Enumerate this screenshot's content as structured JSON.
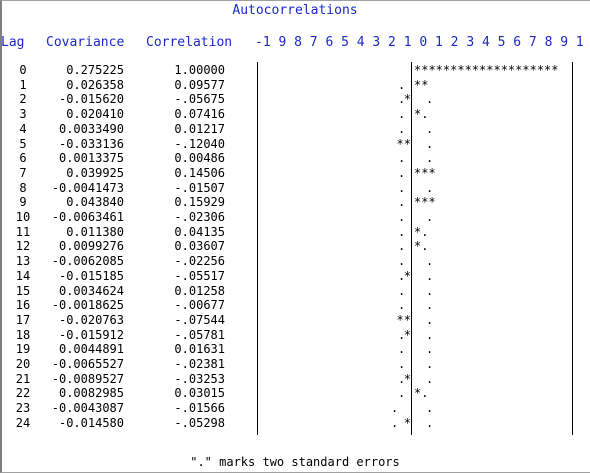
{
  "title": "Autocorrelations",
  "headers": {
    "lag": "Lag",
    "covariance": "Covariance",
    "correlation": "Correlation",
    "scale": "-1 9 8 7 6 5 4 3 2 1 0 1 2 3 4 5 6 7 8 9 1"
  },
  "rows": [
    {
      "lag": "0",
      "cov": "0.275225",
      "cor": "1.00000",
      "bar": "********************",
      "dir": "pos",
      "dots": "none"
    },
    {
      "lag": "1",
      "cov": "0.026358",
      "cor": "0.09577",
      "bar": "**",
      "dir": "pos",
      "dots": "l"
    },
    {
      "lag": "2",
      "cov": "-0.015620",
      "cor": "-.05675",
      "bar": "*",
      "dir": "neg",
      "dots": "lr"
    },
    {
      "lag": "3",
      "cov": "0.020410",
      "cor": "0.07416",
      "bar": "*.",
      "dir": "pos",
      "dots": "l"
    },
    {
      "lag": "4",
      "cov": "0.0033490",
      "cor": "0.01217",
      "bar": "",
      "dir": "pos",
      "dots": "lr"
    },
    {
      "lag": "5",
      "cov": "-0.033136",
      "cor": "-.12040",
      "bar": "**",
      "dir": "neg",
      "dots": "r"
    },
    {
      "lag": "6",
      "cov": "0.0013375",
      "cor": "0.00486",
      "bar": "",
      "dir": "pos",
      "dots": "lr"
    },
    {
      "lag": "7",
      "cov": "0.039925",
      "cor": "0.14506",
      "bar": "***",
      "dir": "pos",
      "dots": "l"
    },
    {
      "lag": "8",
      "cov": "-0.0041473",
      "cor": "-.01507",
      "bar": "",
      "dir": "neg",
      "dots": "lr"
    },
    {
      "lag": "9",
      "cov": "0.043840",
      "cor": "0.15929",
      "bar": "***",
      "dir": "pos",
      "dots": "l"
    },
    {
      "lag": "10",
      "cov": "-0.0063461",
      "cor": "-.02306",
      "bar": "",
      "dir": "neg",
      "dots": "lr"
    },
    {
      "lag": "11",
      "cov": "0.011380",
      "cor": "0.04135",
      "bar": "*.",
      "dir": "pos",
      "dots": "l"
    },
    {
      "lag": "12",
      "cov": "0.0099276",
      "cor": "0.03607",
      "bar": "*.",
      "dir": "pos",
      "dots": "l"
    },
    {
      "lag": "13",
      "cov": "-0.0062085",
      "cor": "-.02256",
      "bar": "",
      "dir": "neg",
      "dots": "lr"
    },
    {
      "lag": "14",
      "cov": "-0.015185",
      "cor": "-.05517",
      "bar": "*",
      "dir": "neg",
      "dots": "lr"
    },
    {
      "lag": "15",
      "cov": "0.0034624",
      "cor": "0.01258",
      "bar": "",
      "dir": "pos",
      "dots": "lr"
    },
    {
      "lag": "16",
      "cov": "-0.0018625",
      "cor": "-.00677",
      "bar": "",
      "dir": "neg",
      "dots": "lr"
    },
    {
      "lag": "17",
      "cov": "-0.020763",
      "cor": "-.07544",
      "bar": "**",
      "dir": "neg",
      "dots": "r"
    },
    {
      "lag": "18",
      "cov": "-0.015912",
      "cor": "-.05781",
      "bar": "*",
      "dir": "neg",
      "dots": "lr"
    },
    {
      "lag": "19",
      "cov": "0.0044891",
      "cor": "0.01631",
      "bar": "",
      "dir": "pos",
      "dots": "lr"
    },
    {
      "lag": "20",
      "cov": "-0.0065527",
      "cor": "-.02381",
      "bar": "",
      "dir": "neg",
      "dots": "lr"
    },
    {
      "lag": "21",
      "cov": "-0.0089527",
      "cor": "-.03253",
      "bar": "*",
      "dir": "neg",
      "dots": "lr"
    },
    {
      "lag": "22",
      "cov": "0.0082985",
      "cor": "0.03015",
      "bar": "*.",
      "dir": "pos",
      "dots": "l"
    },
    {
      "lag": "23",
      "cov": "-0.0043087",
      "cor": "-.01566",
      "bar": "",
      "dir": "neg",
      "dots": "lr2"
    },
    {
      "lag": "24",
      "cov": "-0.014580",
      "cor": "-.05298",
      "bar": "*",
      "dir": "neg",
      "dots": "lr2"
    }
  ],
  "footnote": "\".\" marks two standard errors",
  "colors": {
    "header": "#1a28c8",
    "text": "#000000"
  }
}
